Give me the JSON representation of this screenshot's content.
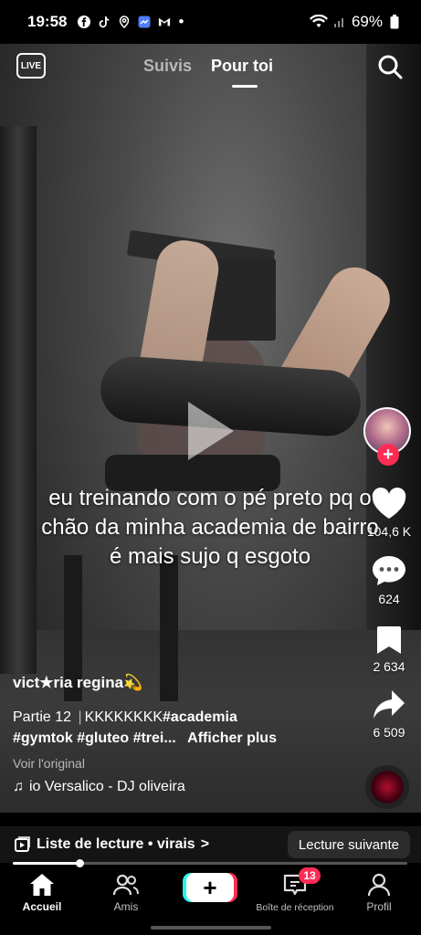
{
  "status_bar": {
    "time": "19:58",
    "battery": "69%",
    "more_dot": "•"
  },
  "top_nav": {
    "live_label": "LIVE",
    "tabs": [
      {
        "label": "Suivis",
        "active": false
      },
      {
        "label": "Pour toi",
        "active": true
      }
    ]
  },
  "video": {
    "overlay_caption": "eu treinando com o pé preto pq o chão da minha academia de bairro é mais sujo q esgoto",
    "progress_fraction": 0.17
  },
  "right_rail": {
    "likes": "104,6 K",
    "comments": "624",
    "saves": "2 634",
    "shares": "6 509"
  },
  "post": {
    "username": "vict★ria regina💫",
    "part": "Partie 12",
    "separator": "|",
    "desc_line1_text": "KKKKKKKK",
    "hashtags_line1": "#academia",
    "hashtags_line2": "#gymtok #gluteo #trei...",
    "more_label": "Afficher plus",
    "see_original": "Voir l'original",
    "music": "io Versalico - DJ oliveira"
  },
  "playlist": {
    "label": "Liste de lecture • virais",
    "chevron": ">",
    "next_button": "Lecture suivante"
  },
  "bottom_nav": {
    "items": [
      {
        "label": "Accueil",
        "icon": "home-icon",
        "active": true
      },
      {
        "label": "Amis",
        "icon": "friends-icon",
        "active": false
      },
      {
        "label": "+",
        "icon": "create-icon",
        "active": false
      },
      {
        "label": "Boîte de réception",
        "icon": "inbox-icon",
        "active": false,
        "badge": "13"
      },
      {
        "label": "Profil",
        "icon": "profile-icon",
        "active": false
      }
    ]
  },
  "colors": {
    "accent": "#fe2c55",
    "accent_cyan": "#25f4ee",
    "background": "#000000"
  }
}
